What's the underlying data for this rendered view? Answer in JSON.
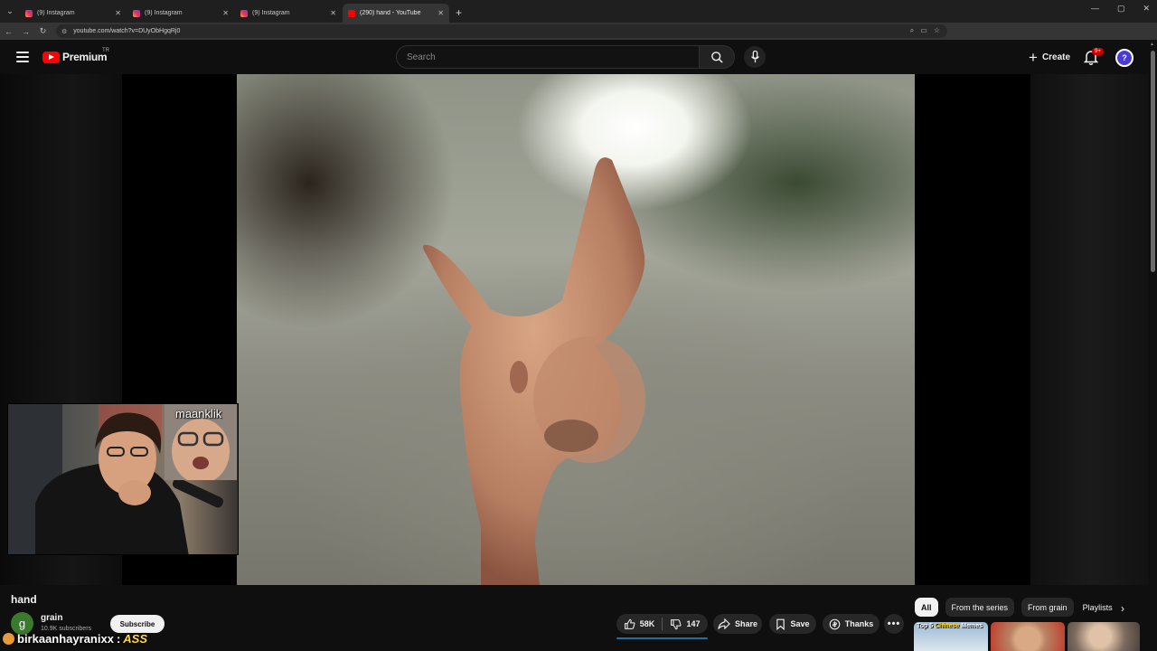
{
  "browser": {
    "tabs": [
      {
        "title": "(9) Instagram",
        "icon": "instagram-icon",
        "active": false
      },
      {
        "title": "(9) Instagram",
        "icon": "instagram-icon",
        "active": false
      },
      {
        "title": "(9) Instagram",
        "icon": "instagram-icon",
        "active": false
      },
      {
        "title": "(290) hand - YouTube",
        "icon": "youtube-icon",
        "active": true
      }
    ],
    "url": "youtube.com/watch?v=DUyObHgqRj0"
  },
  "header": {
    "logo_text": "Premium",
    "logo_region": "TR",
    "search_placeholder": "Search",
    "create_label": "Create",
    "notification_badge": "9+",
    "brand_color": "#ff0000"
  },
  "player": {
    "webcam_label": "maanklik"
  },
  "video": {
    "title": "hand",
    "channel": {
      "initial": "g",
      "name": "grain",
      "subscribers": "10.9K subscribers",
      "subscribe_label": "Subscribe"
    },
    "overlay_user": "birkaanhayranixx",
    "overlay_sep": ":",
    "overlay_word": "ASS",
    "actions": {
      "likes": "58K",
      "dislikes": "147",
      "share": "Share",
      "save": "Save",
      "thanks": "Thanks"
    }
  },
  "related": {
    "chips": [
      "All",
      "From the series",
      "From grain",
      "Playlists"
    ],
    "thumb1_text_a": "Top 5 ",
    "thumb1_text_b": "Chinese",
    "thumb1_text_c": " Memes"
  }
}
